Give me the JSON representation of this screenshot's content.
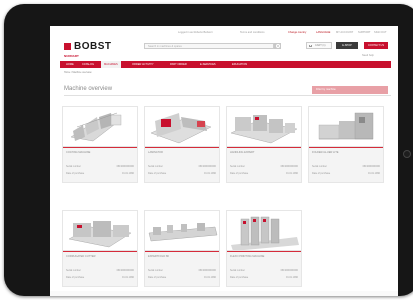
{
  "util_bar": {
    "items": [
      "Logged in as Roberto Bellucci",
      "Terms and conditions",
      "Change country",
      "LANGUAGE",
      "MY ACCOUNT",
      "SUPPORT",
      "SIGN OUT"
    ]
  },
  "header": {
    "brand": "BOBST",
    "search_placeholder": "Search in machines & spares",
    "cart_label": "CART (1)",
    "quick_order_label": "E-SHOP",
    "contact_label": "CONTACT US",
    "user_name": "NURDART",
    "help_link": "Need help"
  },
  "nav": {
    "items": [
      "HOME",
      "CATALOG",
      "MACHINES",
      "ORDER ACTIVITY",
      "PART ORDER",
      "E-SERVICES",
      "EDUCATION"
    ],
    "active_index": 2
  },
  "breadcrumb": "Home / Machine overview",
  "page": {
    "title": "Machine overview",
    "filter_label": "Filter by machine"
  },
  "machines": [
    {
      "name": "COATING MACHINE",
      "serial_label": "Serial number",
      "serial": "06F2000000000",
      "date_label": "Date of purchase",
      "date": "01.01.1990",
      "icon": "rotary-press-machine-image"
    },
    {
      "name": "LAMINATOR",
      "serial_label": "Serial number",
      "serial": "06F2000000000",
      "date_label": "Date of purchase",
      "date": "01.01.1990",
      "icon": "laminator-machine-image"
    },
    {
      "name": "HANDLING EXPERT",
      "serial_label": "Serial number",
      "serial": "06F2000000000",
      "date_label": "Date of purchase",
      "date": "01.01.1990",
      "icon": "die-cutter-machine-image"
    },
    {
      "name": "FOLDER-GLUER LITE",
      "serial_label": "Serial number",
      "serial": "06F2000000000",
      "date_label": "Date of purchase",
      "date": "01.01.1990",
      "icon": "folder-gluer-machine-image"
    },
    {
      "name": "CORRUGATED CUTTER",
      "serial_label": "Serial number",
      "serial": "06F2000000000",
      "date_label": "Date of purchase",
      "date": "01.01.1990",
      "icon": "corrugated-cutter-machine-image"
    },
    {
      "name": "EXPERTFOLD 80",
      "serial_label": "Serial number",
      "serial": "06F2000000000",
      "date_label": "Date of purchase",
      "date": "01.01.1990",
      "icon": "expertfold-machine-image"
    },
    {
      "name": "FLEXO PRINTING MACHINE",
      "serial_label": "Serial number",
      "serial": "06F2000000000",
      "date_label": "Date of purchase",
      "date": "01.01.1990",
      "icon": "flexo-press-machine-image"
    }
  ],
  "colors": {
    "brand_red": "#c8102e",
    "filter_pink": "#e8a0a6",
    "tablet_frame": "#161616"
  }
}
